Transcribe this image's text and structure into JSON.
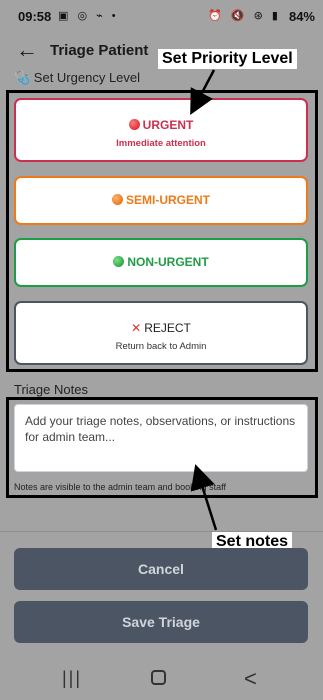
{
  "status_bar": {
    "time": "09:58",
    "left_icons": "▣ ◎ ⌁ •",
    "right_icons": "⏰ 🔇 ⊛ ▮",
    "battery": "84%"
  },
  "header": {
    "back_icon": "←",
    "title": "Triage Patient"
  },
  "section_label": "🩺 Set Urgency Level",
  "priority": {
    "urgent": {
      "title": "URGENT",
      "subtitle": "Immediate attention",
      "color": "#c9314e"
    },
    "semi_urgent": {
      "title": "SEMI-URGENT",
      "color": "#ef7a1a"
    },
    "non_urgent": {
      "title": "NON-URGENT",
      "color": "#1f9d46"
    },
    "reject": {
      "icon": "✕",
      "title": "REJECT",
      "subtitle": "Return back to Admin",
      "color": "#4b5563"
    }
  },
  "notes": {
    "label": "Triage Notes",
    "placeholder": "Add your triage notes, observations, or instructions for admin team...",
    "hint": "Notes are visible to the admin team and booking staff"
  },
  "callouts": {
    "priority": "Set Priority Level",
    "notes": "Set notes"
  },
  "actions": {
    "cancel": "Cancel",
    "save": "Save Triage"
  },
  "nav": {
    "recent": "|||",
    "back": "<"
  }
}
